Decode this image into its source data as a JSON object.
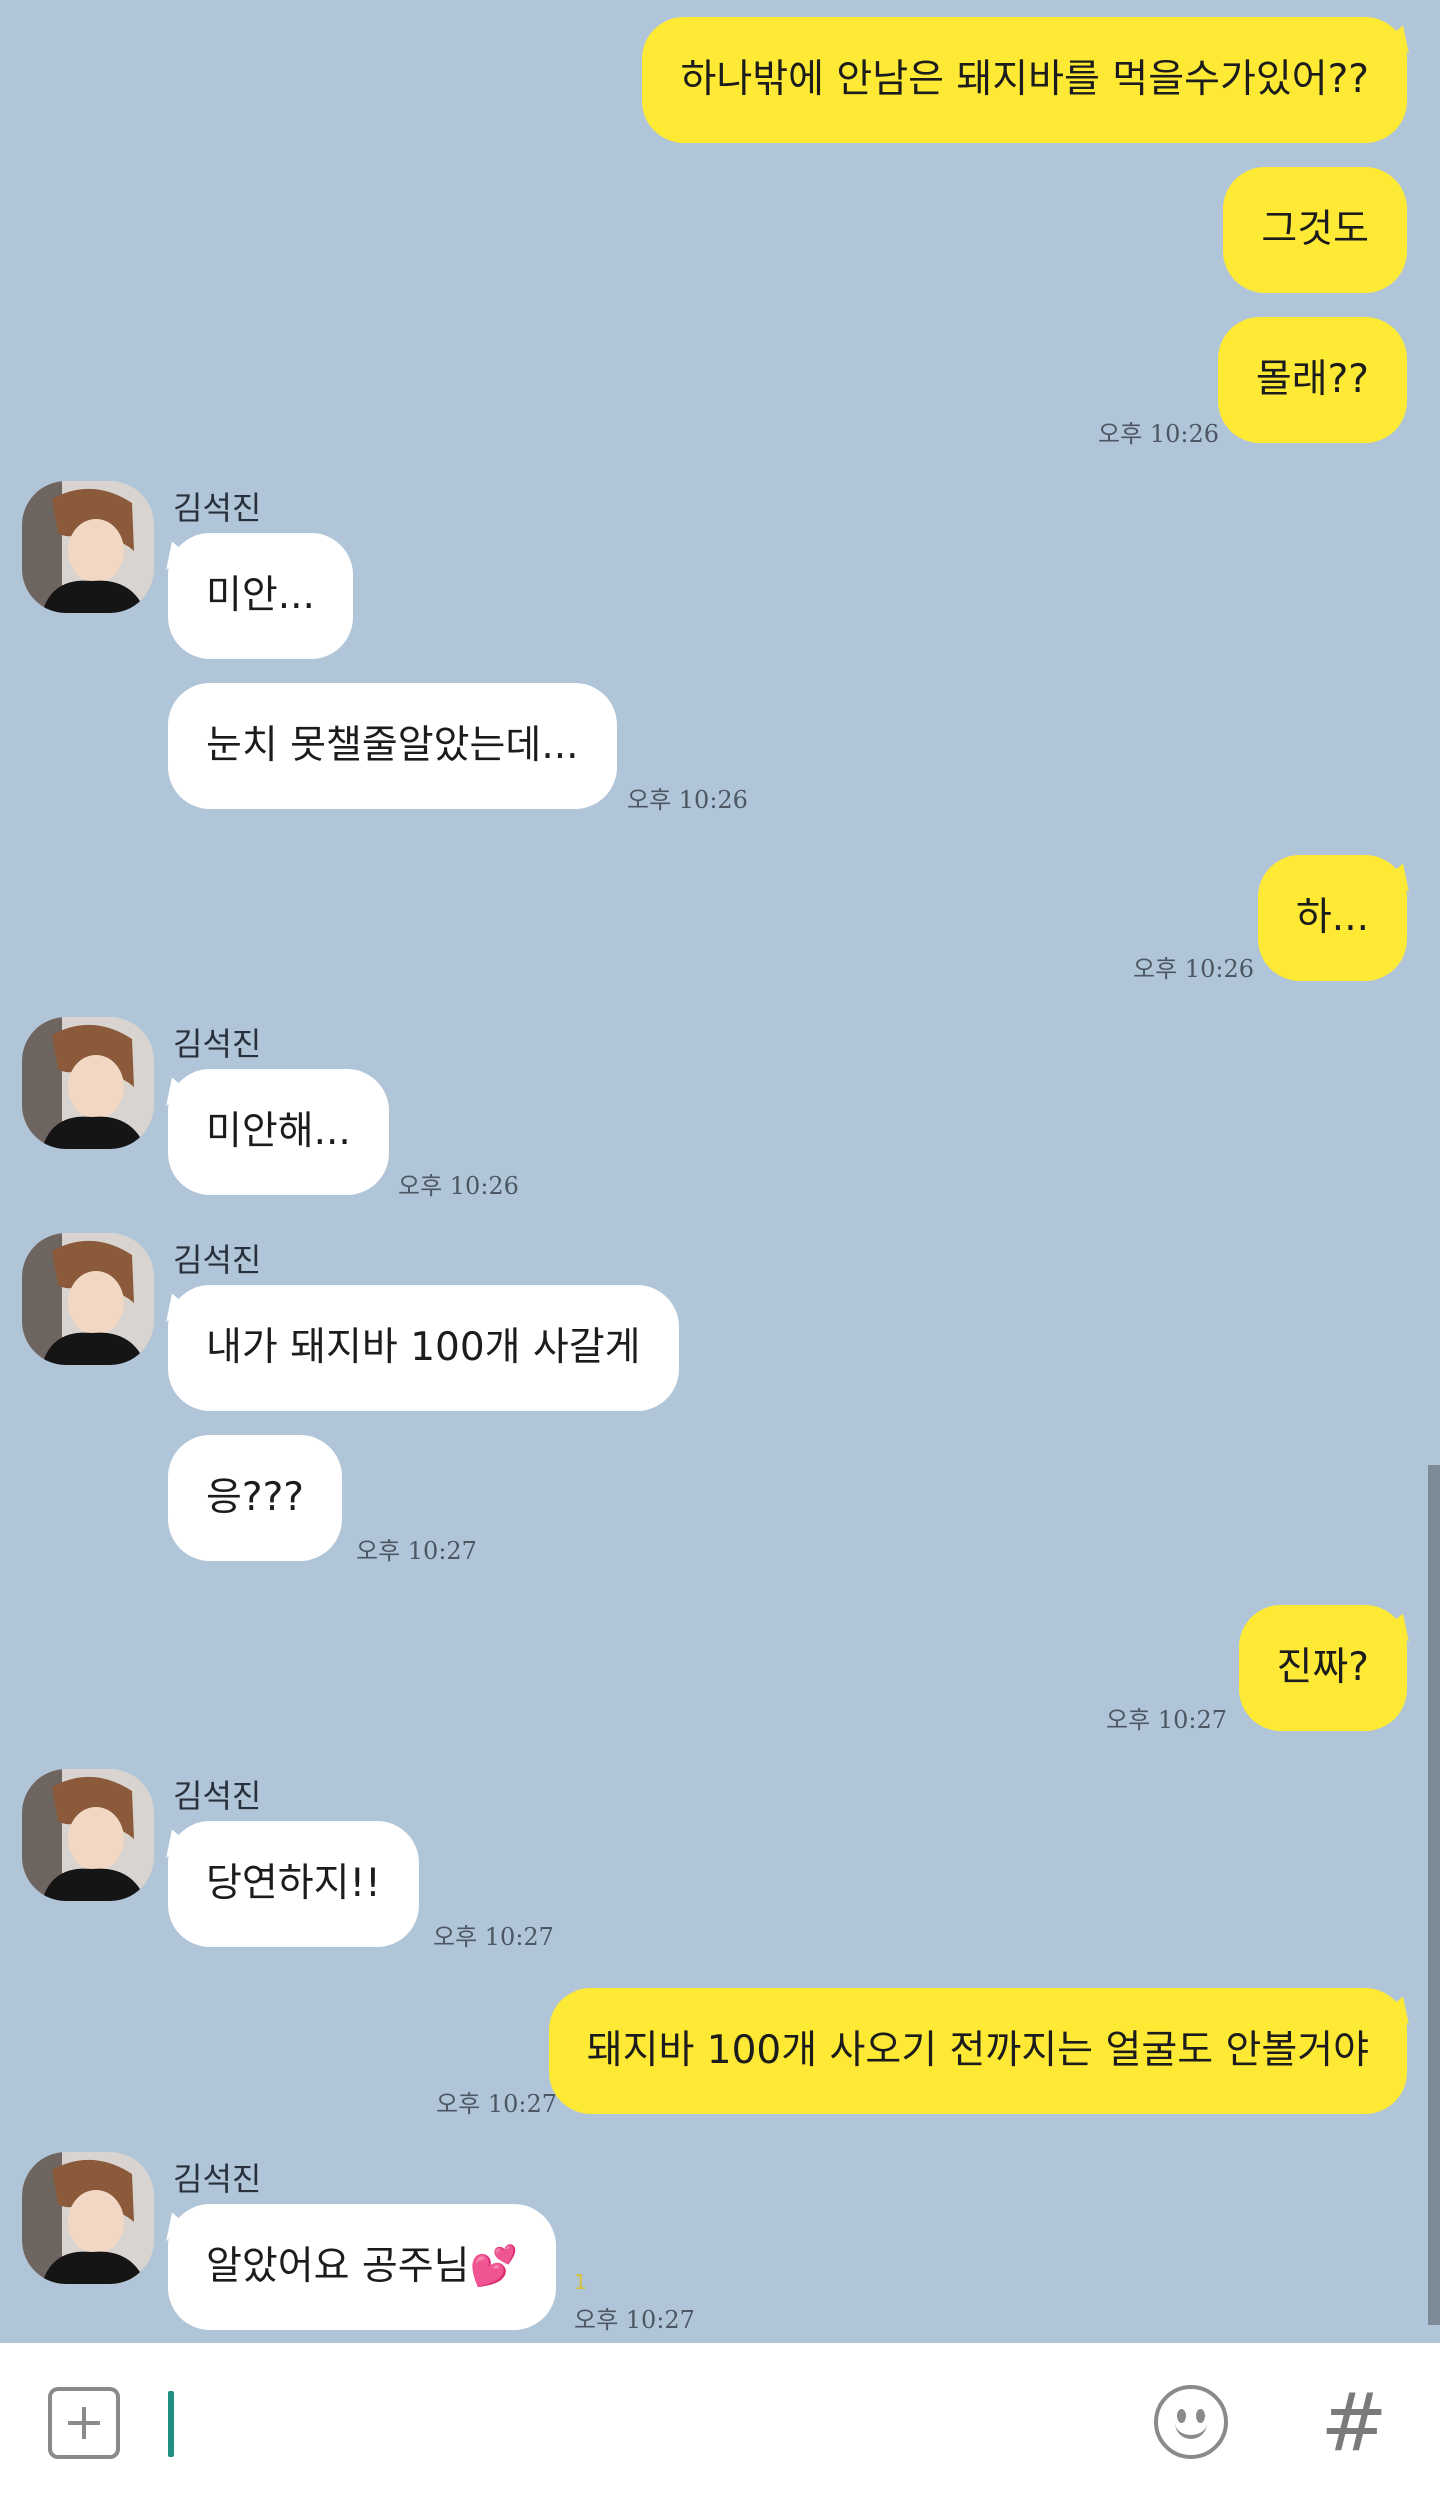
{
  "sender_name": "김석진",
  "messages": {
    "m1": "하나밖에 안남은 돼지바를 먹을수가있어??",
    "m2": "그것도",
    "m3": "몰래??",
    "m4": "미안...",
    "m5": "눈치 못챌줄알았는데...",
    "m6": "하...",
    "m7": "미안해...",
    "m8": "내가 돼지바 100개 사갈게",
    "m9": "응???",
    "m10": "진짜?",
    "m11": "당연하지!!",
    "m12": "돼지바 100개 사오기 전까지는 얼굴도 안볼거야",
    "m13": "알았어요 공주님💕"
  },
  "times": {
    "t1": "오후 10:26",
    "t2": "오후 10:26",
    "t3": "오후 10:26",
    "t4": "오후 10:26",
    "t5": "오후 10:27",
    "t6": "오후 10:27",
    "t7": "오후 10:27",
    "t8": "오후 10:27",
    "t9": "오후 10:27"
  },
  "unread_count": "1",
  "input_bar": {
    "plus_icon": "plus-square-icon",
    "emoji_icon": "smile-icon",
    "hash_label": "#"
  },
  "colors": {
    "background": "#b1c5d8",
    "my_bubble": "#fee934",
    "their_bubble": "#ffffff"
  }
}
